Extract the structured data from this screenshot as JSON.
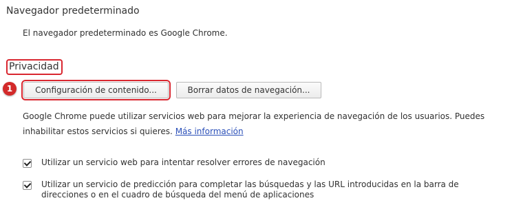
{
  "default_browser": {
    "title": "Navegador predeterminado",
    "text": "El navegador predeterminado es Google Chrome."
  },
  "privacy": {
    "title": "Privacidad",
    "step_number": "1",
    "content_settings_button": "Configuración de contenido...",
    "clear_data_button": "Borrar datos de navegación...",
    "description": "Google Chrome puede utilizar servicios web para mejorar la experiencia de navegación de los usuarios. Puedes inhabilitar estos servicios si quieres.",
    "more_info_link": "Más información",
    "options": [
      {
        "label": "Utilizar un servicio web para intentar resolver errores de navegación",
        "checked": true
      },
      {
        "label": "Utilizar un servicio de predicción para completar las búsquedas y las URL introducidas en la barra de direcciones o en el cuadro de búsqueda del menú de aplicaciones",
        "checked": true
      }
    ]
  },
  "colors": {
    "highlight": "#d9262f",
    "link": "#2a4fb8",
    "badge": "#d32a2a"
  }
}
